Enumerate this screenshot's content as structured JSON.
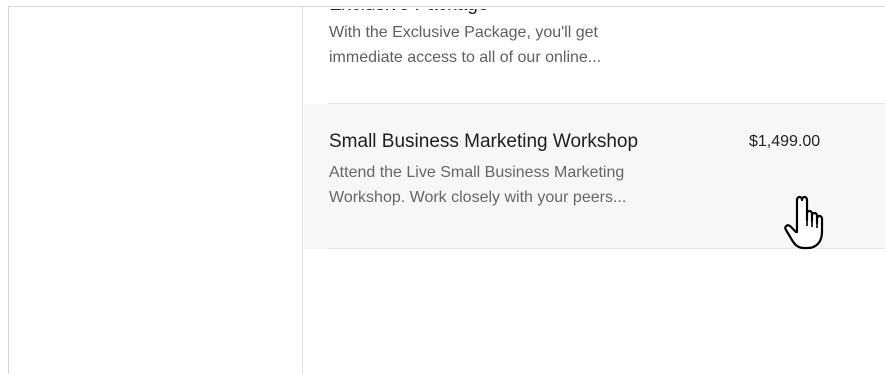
{
  "products": [
    {
      "title_partial": "Exclusive Package",
      "description_line1": "With the Exclusive Package, you'll get",
      "description_line2": "immediate access to all of our online..."
    },
    {
      "title": "Small Business Marketing Workshop",
      "price": "$1,499.00",
      "description_line1": "Attend the Live Small Business Marketing",
      "description_line2": "Workshop. Work closely with your peers..."
    }
  ],
  "cursor": {
    "icon": "hand-pointer-icon"
  },
  "colors": {
    "selected_row_bg": "#f7f7f7",
    "text_primary": "#1e1e1e",
    "text_secondary": "#666666",
    "divider": "#e6e6e6"
  }
}
